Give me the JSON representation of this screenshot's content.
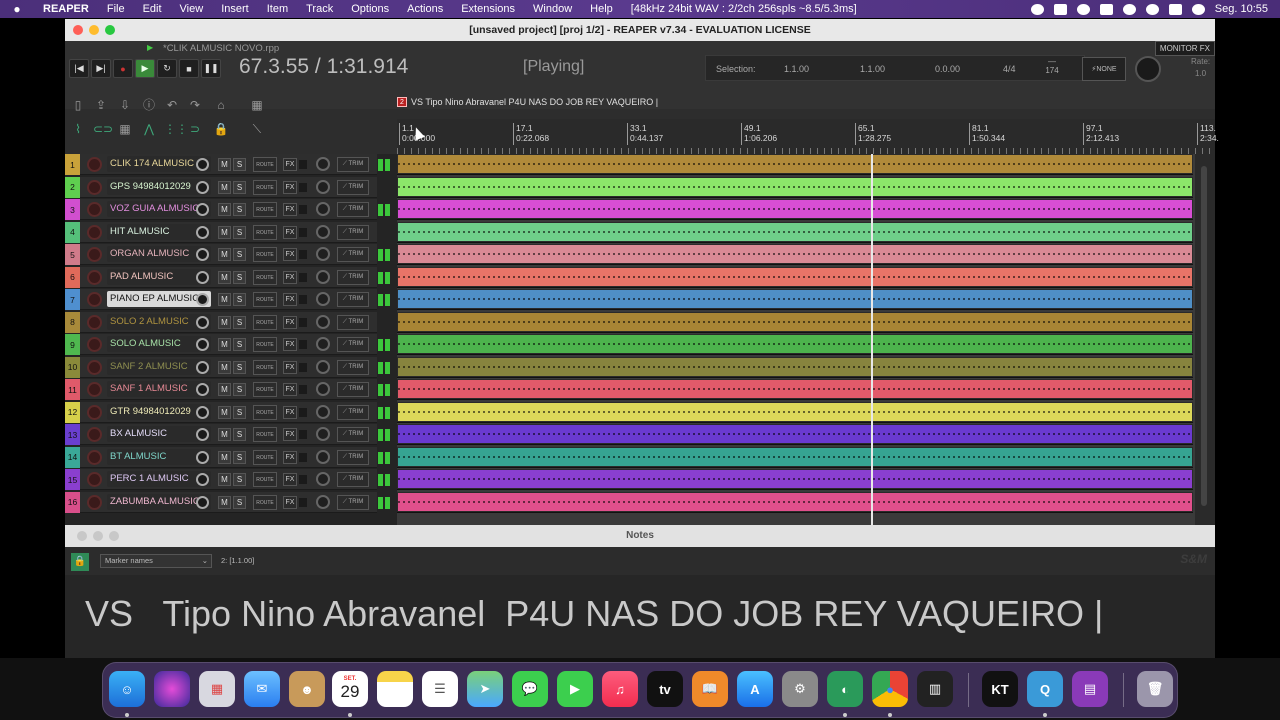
{
  "menubar": {
    "apple": "",
    "items": [
      "REAPER",
      "File",
      "Edit",
      "View",
      "Insert",
      "Item",
      "Track",
      "Options",
      "Actions",
      "Extensions",
      "Window",
      "Help",
      "[48kHz 24bit WAV : 2/2ch 256spls ~8.5/5.3ms]"
    ],
    "clock": "Seg.  10:55"
  },
  "window": {
    "title": "[unsaved project] [proj 1/2] - REAPER v7.34 - EVALUATION LICENSE"
  },
  "transport": {
    "project_file": "*CLIK ALMUSIC NOVO.rpp",
    "monitor_fx": "MONITOR FX",
    "time": "67.3.55 / 1:31.914",
    "status": "[Playing]",
    "selection_label": "Selection:",
    "sel_start": "1.1.00",
    "sel_end": "1.1.00",
    "sel_length": "0.0.00",
    "time_sig": "4/4",
    "bpm": "174",
    "none_btn": "NONE",
    "rate_label": "Rate:",
    "rate_value": "1.0"
  },
  "region": {
    "marker": "2",
    "label": "VS   Tipo Nino Abravanel  P4U NAS DO JOB REY VAQUEIRO |"
  },
  "ruler": [
    {
      "bar": "1.1",
      "time": "0:00.000"
    },
    {
      "bar": "17.1",
      "time": "0:22.068"
    },
    {
      "bar": "33.1",
      "time": "0:44.137"
    },
    {
      "bar": "49.1",
      "time": "1:06.206"
    },
    {
      "bar": "65.1",
      "time": "1:28.275"
    },
    {
      "bar": "81.1",
      "time": "1:50.344"
    },
    {
      "bar": "97.1",
      "time": "2:12.413"
    },
    {
      "bar": "113.",
      "time": "2:34."
    }
  ],
  "tracks": [
    {
      "num": "1",
      "name": "CLIK 174 ALMUSIC",
      "color": "#c9a23a",
      "namecolor": "#e8d79a",
      "item": "#b08a3a"
    },
    {
      "num": "2",
      "name": "GPS 94984012029",
      "color": "#5fcf4f",
      "namecolor": "#d8f5d0",
      "item": "#8ce66a"
    },
    {
      "num": "3",
      "name": "VOZ GUIA ALMUSIC",
      "color": "#d14fcf",
      "namecolor": "#e48fe0",
      "item": "#d84ed4"
    },
    {
      "num": "4",
      "name": "HIT ALMUSIC",
      "color": "#55c07a",
      "namecolor": "#d9f1df",
      "item": "#6fcf8a"
    },
    {
      "num": "5",
      "name": "ORGAN ALMUSIC",
      "color": "#d07b8a",
      "namecolor": "#e5b3bb",
      "item": "#d98a95"
    },
    {
      "num": "6",
      "name": "PAD ALMUSIC",
      "color": "#e06a5a",
      "namecolor": "#f1c4be",
      "item": "#e87468"
    },
    {
      "num": "7",
      "name": "PIANO EP ALMUSIC",
      "color": "#4f8fcf",
      "namecolor": "#111111",
      "item": "#4f8fc6",
      "selected": true
    },
    {
      "num": "8",
      "name": "SOLO 2 ALMUSIC",
      "color": "#a88a3a",
      "namecolor": "#b09440",
      "item": "#a88535"
    },
    {
      "num": "9",
      "name": "SOLO ALMUSIC",
      "color": "#4fb84f",
      "namecolor": "#a8e2a8",
      "item": "#4db34d"
    },
    {
      "num": "10",
      "name": "SANF 2 ALMUSIC",
      "color": "#8a8a3a",
      "namecolor": "#8f8f50",
      "item": "#87843e"
    },
    {
      "num": "11",
      "name": "SANF 1 ALMUSIC",
      "color": "#e05a6a",
      "namecolor": "#e88a96",
      "item": "#e25a6a"
    },
    {
      "num": "12",
      "name": "GTR 94984012029",
      "color": "#d6d04a",
      "namecolor": "#f0ecb8",
      "item": "#dcd85a"
    },
    {
      "num": "13",
      "name": "BX ALMUSIC",
      "color": "#6a3fcf",
      "namecolor": "#e3dbf7",
      "item": "#6a3ad0"
    },
    {
      "num": "14",
      "name": "BT ALMUSIC",
      "color": "#3aa898",
      "namecolor": "#7fd6ca",
      "item": "#36a492"
    },
    {
      "num": "15",
      "name": "PERC 1 ALMUSIC",
      "color": "#8a3fcf",
      "namecolor": "#dfc9f5",
      "item": "#8a3fd0"
    },
    {
      "num": "16",
      "name": "ZABUMBA ALMUSIC",
      "color": "#d84f8a",
      "namecolor": "#f0b8d0",
      "item": "#e0508c"
    }
  ],
  "track_buttons": {
    "mute": "M",
    "solo": "S",
    "route": "ROUTE",
    "fx": "FX",
    "trim": "TRIM"
  },
  "notes": {
    "title": "Notes",
    "dropdown": "Marker names",
    "position": "2:  [1.1.00]",
    "brand": "S&M",
    "text": "VS   Tipo Nino Abravanel  P4U NAS DO JOB REY VAQUEIRO |"
  },
  "dock": {
    "calendar_month": "SET.",
    "calendar_day": "29",
    "appletv": "tv",
    "kt": "KT",
    "apps": [
      "finder-icon",
      "siri-icon",
      "launchpad-icon",
      "mail-icon",
      "contacts-icon",
      "calendar-icon",
      "notes-icon",
      "reminders-icon",
      "maps-icon",
      "messages-icon",
      "facetime-icon",
      "music-icon",
      "appletv-icon",
      "books-icon",
      "appstore-icon",
      "settings-icon",
      "reaper-icon",
      "chrome-icon",
      "piano-icon",
      "kt-icon",
      "quicktime-icon",
      "notebook-icon",
      "trash-icon"
    ]
  }
}
